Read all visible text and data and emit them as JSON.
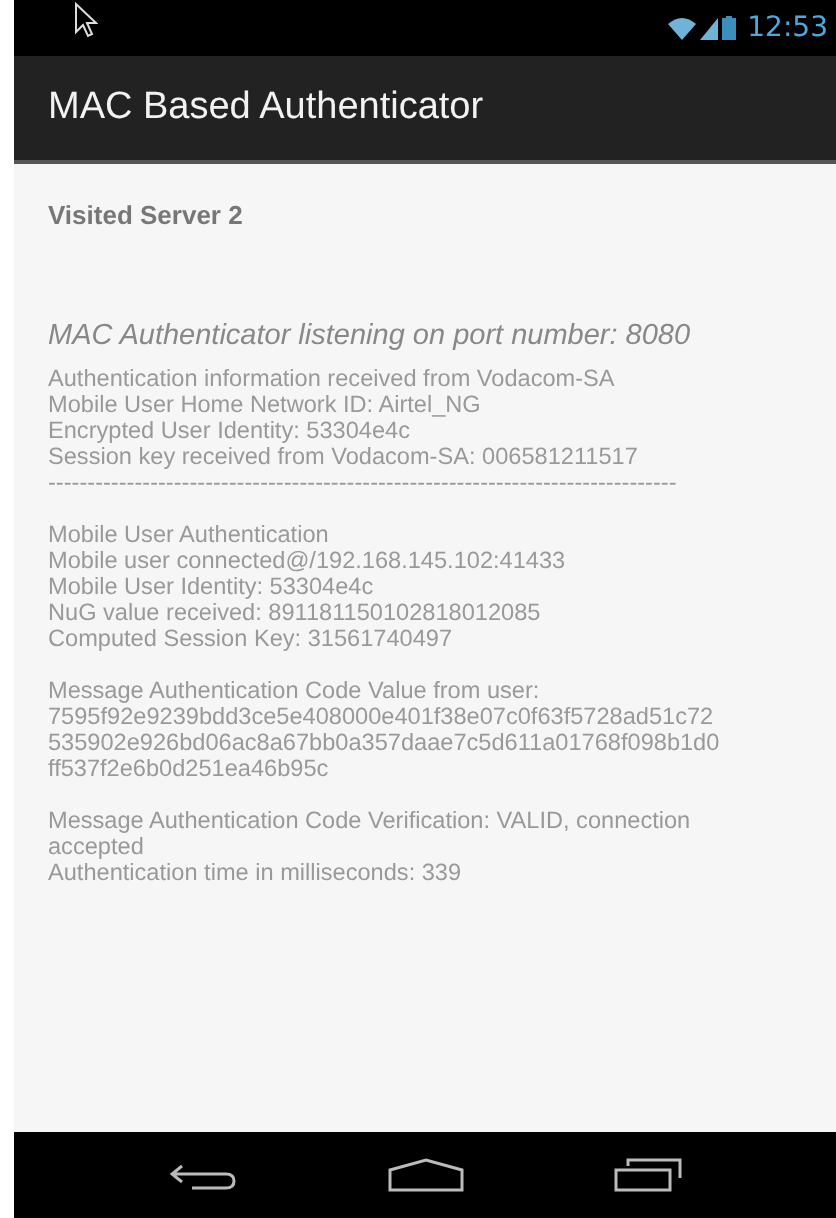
{
  "status_bar": {
    "time": "12:53"
  },
  "app_bar": {
    "title": "MAC Based Authenticator"
  },
  "heading": "Visited Server 2",
  "listening": "MAC Authenticator listening on port number: 8080",
  "log_blocks": [
    {
      "lines": [
        "Authentication information received from Vodacom-SA",
        "Mobile User Home Network ID: Airtel_NG",
        "Encrypted User Identity: 53304e4c",
        "Session key received from Vodacom-SA: 006581211517",
        "--------------------------------------------------------------------------------"
      ]
    },
    {
      "lines": [
        "Mobile User Authentication",
        "Mobile user connected@/192.168.145.102:41433",
        "Mobile User Identity: 53304e4c",
        "NuG value received: 891181150102818012085",
        "Computed Session Key: 31561740497"
      ]
    },
    {
      "lines": [
        "Message Authentication Code Value from user:",
        "7595f92e9239bdd3ce5e408000e401f38e07c0f63f5728ad51c72",
        "535902e926bd06ac8a67bb0a357daae7c5d611a01768f098b1d0",
        "ff537f2e6b0d251ea46b95c"
      ]
    },
    {
      "lines": [
        "Message Authentication Code Verification: VALID, connection",
        "accepted",
        "Authentication time in milliseconds: 339"
      ]
    }
  ]
}
